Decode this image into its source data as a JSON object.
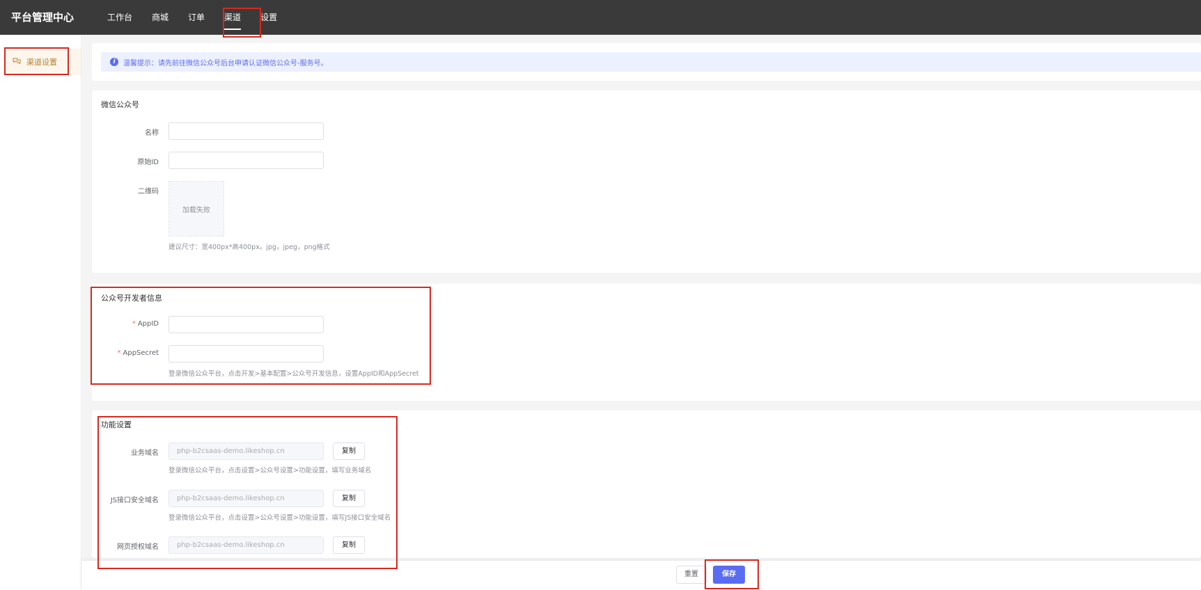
{
  "header": {
    "brand": "平台管理中心",
    "nav": [
      "工作台",
      "商城",
      "订单",
      "渠道",
      "设置"
    ],
    "active_nav": "渠道"
  },
  "sidebar": {
    "items": [
      {
        "label": "渠道设置",
        "icon": "chat-bubbles-icon"
      }
    ]
  },
  "tip": {
    "icon": "info-icon",
    "text": "温馨提示：请先前往微信公众号后台申请认证微信公众号-服务号。"
  },
  "wechat_account": {
    "title": "微信公众号",
    "name_label": "名称",
    "name_value": "",
    "original_id_label": "原始ID",
    "original_id_value": "",
    "qrcode_label": "二维码",
    "qrcode_placeholder": "加载失败",
    "qrcode_hint": "建议尺寸：宽400px*高400px。jpg，jpeg，png格式"
  },
  "developer": {
    "title": "公众号开发者信息",
    "appid_label": "AppID",
    "appid_value": "",
    "appsecret_label": "AppSecret",
    "appsecret_value": "",
    "hint": "登录微信公众平台，点击开发>基本配置>公众号开发信息，设置AppID和AppSecret"
  },
  "features": {
    "title": "功能设置",
    "business_domain_label": "业务域名",
    "business_domain_value": "php-b2csaas-demo.likeshop.cn",
    "business_domain_hint": "登录微信公众平台，点击设置>公众号设置>功能设置，填写业务域名",
    "js_domain_label": "JS接口安全域名",
    "js_domain_value": "php-b2csaas-demo.likeshop.cn",
    "js_domain_hint": "登录微信公众平台，点击设置>公众号设置>功能设置，填写JS接口安全域名",
    "oauth_domain_label": "网页授权域名",
    "oauth_domain_value": "php-b2csaas-demo.likeshop.cn",
    "copy_label": "复制"
  },
  "footer": {
    "reset_label": "重置",
    "save_label": "保存"
  },
  "colors": {
    "primary": "#5a6cf1",
    "highlight": "#d8281e",
    "topbar": "#3a3a3a"
  }
}
